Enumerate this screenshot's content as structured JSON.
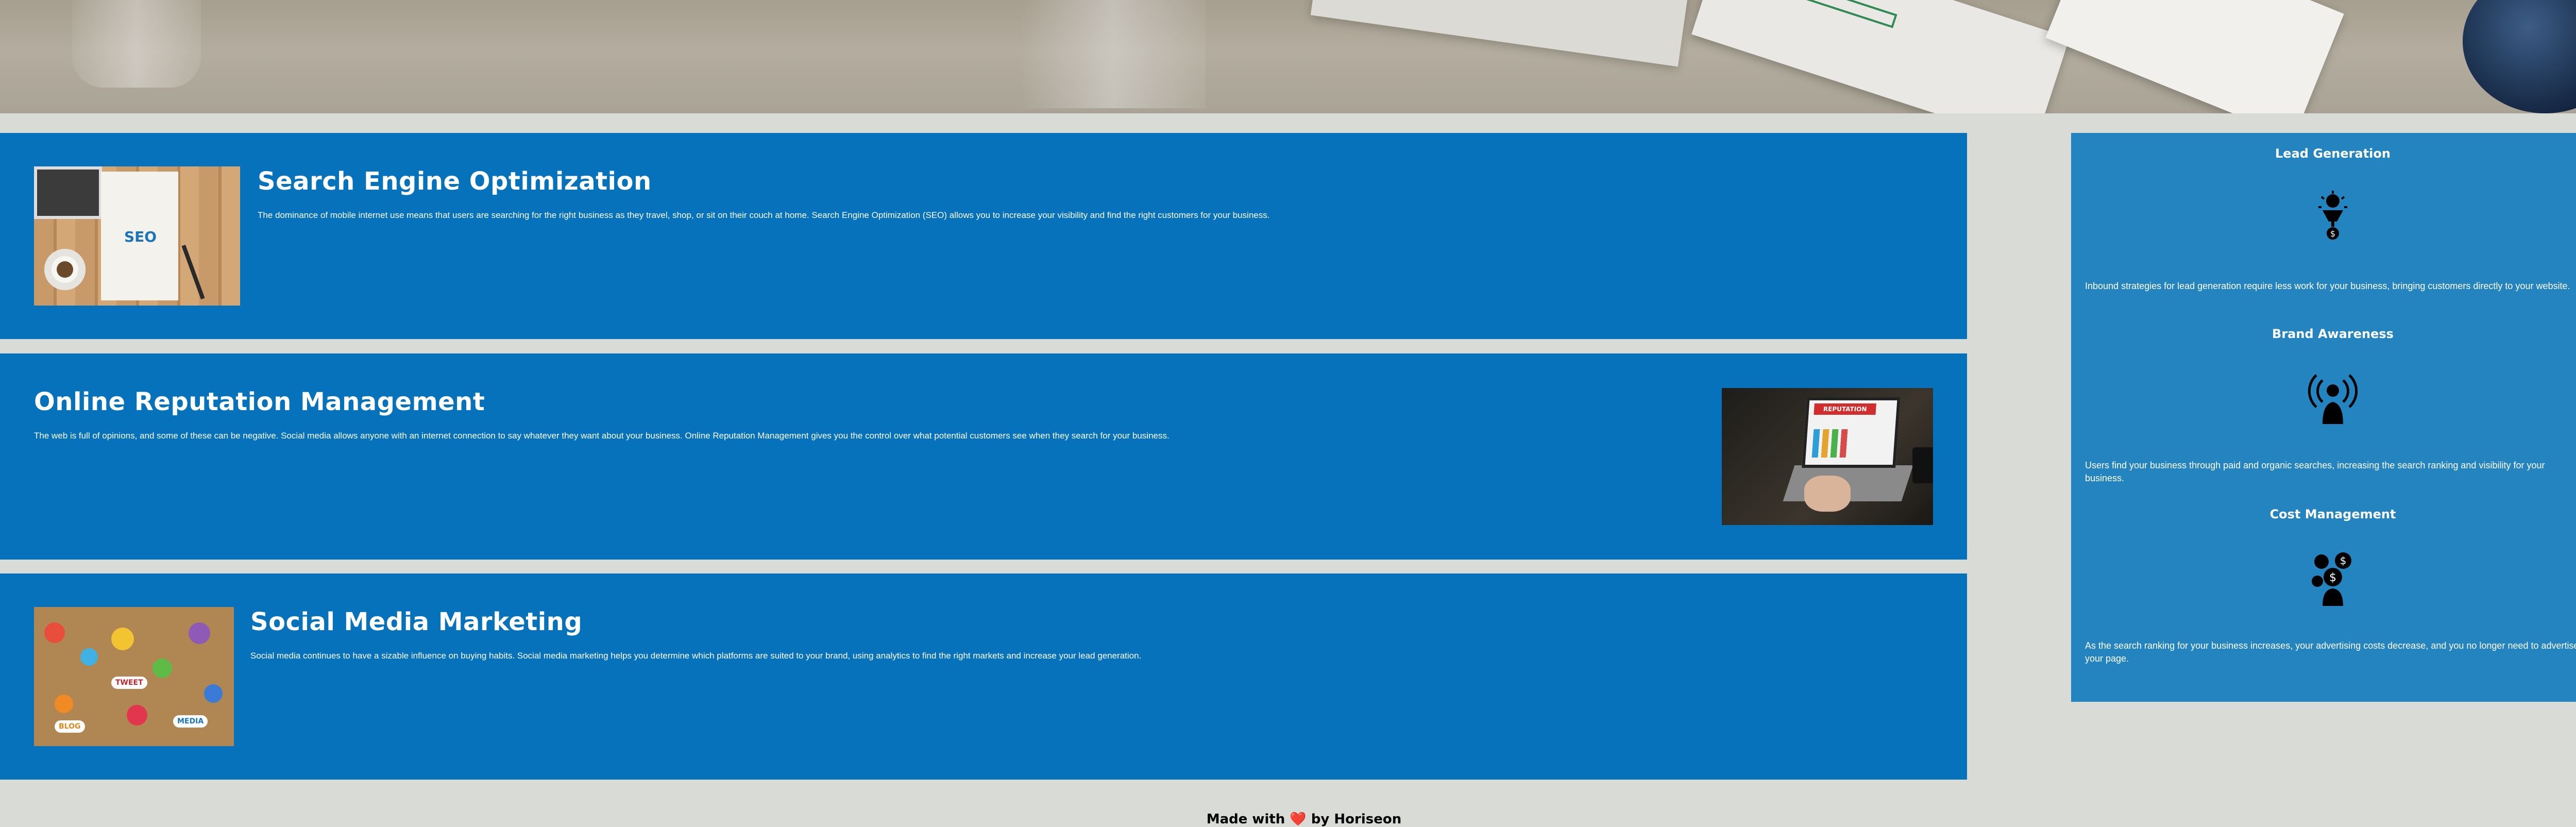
{
  "services": [
    {
      "title": "Search Engine Optimization",
      "body": "The dominance of mobile internet use means that users are searching for the right business as they travel, shop, or sit on their couch at home. Search Engine Optimization (SEO) allows you to increase your visibility and find the right customers for your business.",
      "image_icon": "seo-photo",
      "image_label": "SEO"
    },
    {
      "title": "Online Reputation Management",
      "body": "The web is full of opinions, and some of these can be negative. Social media allows anyone with an internet connection to say whatever they want about your business. Online Reputation Management gives you the control over what potential customers see when they search for your business.",
      "image_icon": "reputation-laptop-photo",
      "image_label": "REPUTATION"
    },
    {
      "title": "Social Media Marketing",
      "body": "Social media continues to have a sizable influence on buying habits. Social media marketing helps you determine which platforms are suited to your brand, using analytics to find the right markets and increase your lead generation.",
      "image_icon": "social-media-collage-photo",
      "image_tags": [
        "TWEET",
        "MEDIA",
        "BLOG"
      ]
    }
  ],
  "benefits": [
    {
      "title": "Lead Generation",
      "icon": "lead-generation-icon",
      "body": "Inbound strategies for lead generation require less work for your business, bringing customers directly to your website."
    },
    {
      "title": "Brand Awareness",
      "icon": "brand-awareness-icon",
      "body": "Users find your business through paid and organic searches, increasing the search ranking and visibility for your business."
    },
    {
      "title": "Cost Management",
      "icon": "cost-management-icon",
      "body": "As the search ranking for your business increases, your advertising costs decrease, and you no longer need to advertise your page."
    }
  ],
  "footer": {
    "prefix": "Made with",
    "heart": "❤️",
    "suffix": "by Horiseon"
  },
  "colors": {
    "page_bg": "#d9dcd6",
    "card_bg": "#0572bb",
    "sidebar_bg": "#2484c0",
    "text": "#ffffff",
    "footer_text": "#000000"
  }
}
